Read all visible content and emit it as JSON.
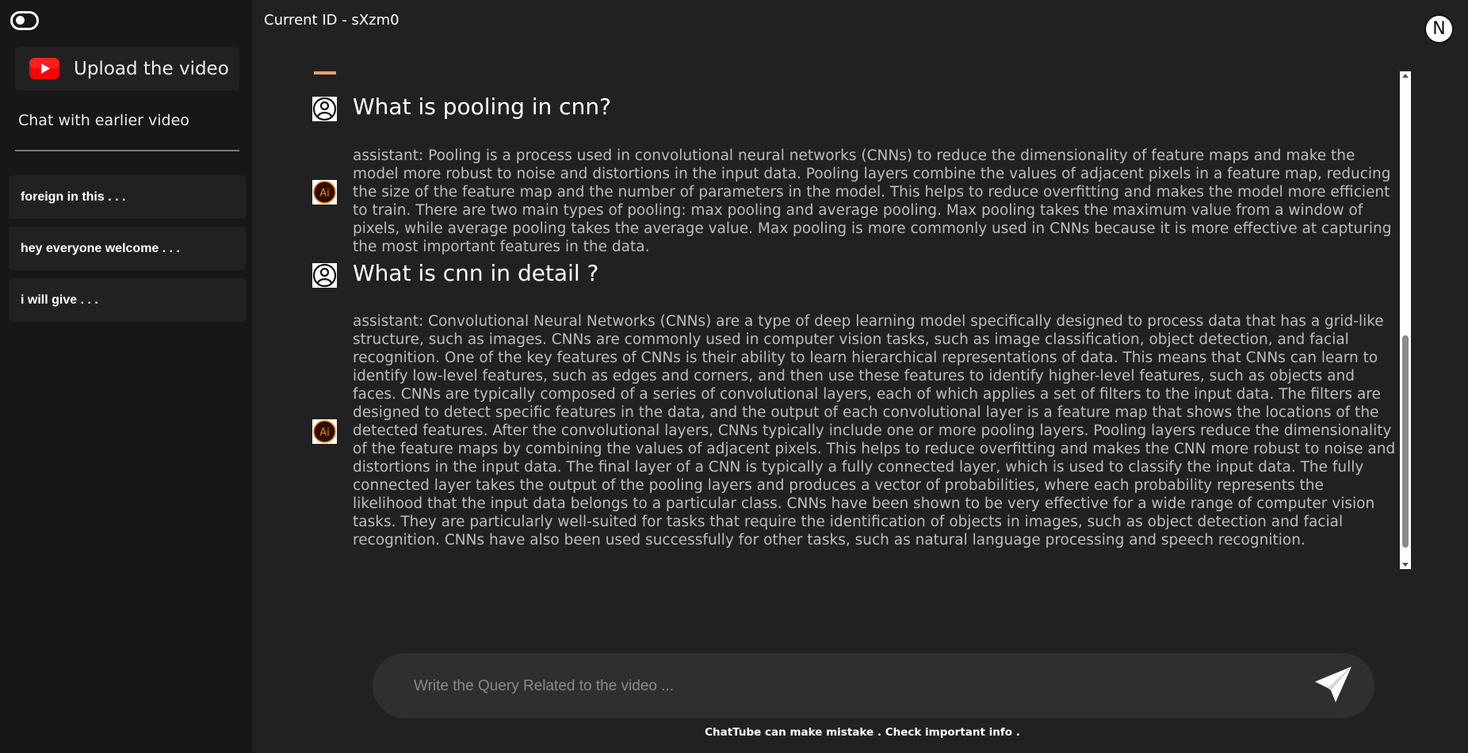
{
  "sidebar": {
    "toggle_icon": "toggle-icon",
    "upload_icon": "youtube-icon",
    "upload_label": "Upload the video",
    "earlier_label": "Chat with earlier video",
    "history": [
      "foreign in this . . .",
      "hey everyone welcome . . .",
      "i will give . . ."
    ]
  },
  "header": {
    "current_id": "Current ID - sXzm0",
    "avatar_initial": "N"
  },
  "chat": {
    "messages": [
      {
        "question": "What is pooling in cnn?",
        "answer": "assistant: Pooling is a process used in convolutional neural networks (CNNs) to reduce the dimensionality of feature maps and make the model more robust to noise and distortions in the input data. Pooling layers combine the values of adjacent pixels in a feature map, reducing the size of the feature map and the number of parameters in the model. This helps to reduce overfitting and makes the model more efficient to train. There are two main types of pooling: max pooling and average pooling. Max pooling takes the maximum value from a window of pixels, while average pooling takes the average value. Max pooling is more commonly used in CNNs because it is more effective at capturing the most important features in the data."
      },
      {
        "question": "What is cnn in detail ?",
        "answer": "assistant: Convolutional Neural Networks (CNNs) are a type of deep learning model specifically designed to process data that has a grid-like structure, such as images. CNNs are commonly used in computer vision tasks, such as image classification, object detection, and facial recognition. One of the key features of CNNs is their ability to learn hierarchical representations of data. This means that CNNs can learn to identify low-level features, such as edges and corners, and then use these features to identify higher-level features, such as objects and faces. CNNs are typically composed of a series of convolutional layers, each of which applies a set of filters to the input data. The filters are designed to detect specific features in the data, and the output of each convolutional layer is a feature map that shows the locations of the detected features. After the convolutional layers, CNNs typically include one or more pooling layers. Pooling layers reduce the dimensionality of the feature maps by combining the values of adjacent pixels. This helps to reduce overfitting and makes the CNN more robust to noise and distortions in the input data. The final layer of a CNN is typically a fully connected layer, which is used to classify the input data. The fully connected layer takes the output of the pooling layers and produces a vector of probabilities, where each probability represents the likelihood that the input data belongs to a particular class. CNNs have been shown to be very effective for a wide range of computer vision tasks. They are particularly well-suited for tasks that require the identification of objects in images, such as object detection and facial recognition. CNNs have also been used successfully for other tasks, such as natural language processing and speech recognition."
      }
    ],
    "ai_icon_label": "Ai"
  },
  "input": {
    "placeholder": "Write the Query Related to the video ...",
    "value": "",
    "send_icon": "send-icon"
  },
  "footer": {
    "disclaimer": "ChatTube can make mistake . Check important info ."
  },
  "colors": {
    "background": "#212121",
    "sidebar": "#171717",
    "input_bg": "#2f2f2f",
    "youtube_red": "#ff0000",
    "ai_orange": "#ff7c00"
  }
}
